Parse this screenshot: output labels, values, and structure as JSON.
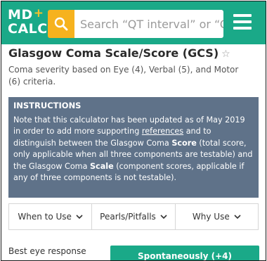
{
  "header": {
    "logo_line1": "MD",
    "logo_plus": "+",
    "logo_line2": "CALC",
    "search_placeholder": "Search “QT interval” or “QT",
    "colors": {
      "brand": "#1aa988",
      "search_accent": "#f6b21e"
    },
    "icons": {
      "search": "search-icon",
      "menu": "hamburger-menu-icon",
      "favorite": "star-outline-icon",
      "chevron": "chevron-down-icon"
    }
  },
  "calculator": {
    "title": "Glasgow Coma Scale/Score (GCS)",
    "star": "☆",
    "subtitle": "Coma severity based on Eye (4), Verbal (5), and Motor (6) criteria."
  },
  "instructions": {
    "heading": "INSTRUCTIONS",
    "text_a": "Note that this calculator has been updated as of May 2019 in order to add more supporting ",
    "link": "references",
    "text_b": " and to distinguish between the Glasgow Coma ",
    "bold_score": "Score",
    "text_c": " (total score, only applicable when all three components are testable) and the Glasgow Coma ",
    "bold_scale": "Scale",
    "text_d": " (component scores, applicable if any of three components is not testable)."
  },
  "tabs": [
    {
      "label": "When to Use"
    },
    {
      "label": "Pearls/Pitfalls"
    },
    {
      "label": "Why Use"
    }
  ],
  "form": {
    "eye_label": "Best eye response",
    "eye_option": "Spontaneously (+4)"
  }
}
